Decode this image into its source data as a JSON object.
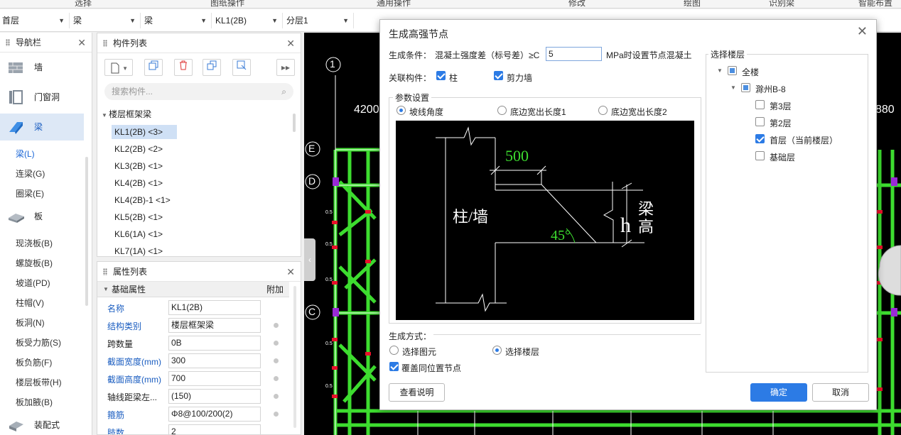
{
  "ribbon": {
    "tabs": [
      "选择",
      "图纸操作",
      "通用操作",
      "修改",
      "绘图",
      "识别梁",
      "智能布置"
    ]
  },
  "selectors": [
    {
      "value": "首层"
    },
    {
      "value": "梁"
    },
    {
      "value": "梁"
    },
    {
      "value": "KL1(2B)"
    },
    {
      "value": "分层1"
    }
  ],
  "nav": {
    "title": "导航栏",
    "categories": [
      {
        "label": "墙",
        "icon": "wall-icon"
      },
      {
        "label": "门窗洞",
        "icon": "door-window-icon"
      },
      {
        "label": "梁",
        "icon": "beam-icon"
      },
      {
        "label": "板",
        "icon": "slab-icon"
      },
      {
        "label": "装配式",
        "icon": "prefab-icon"
      }
    ],
    "beam_items": [
      "梁(L)",
      "连梁(G)",
      "圈梁(E)"
    ],
    "slab_items": [
      "现浇板(B)",
      "螺旋板(B)",
      "坡道(PD)",
      "柱帽(V)",
      "板洞(N)",
      "板受力筋(S)",
      "板负筋(F)",
      "楼层板带(H)",
      "板加腋(B)"
    ]
  },
  "component_list": {
    "title": "构件列表",
    "search_placeholder": "搜索构件...",
    "group": "楼层框架梁",
    "items": [
      "KL1(2B) <3>",
      "KL2(2B) <2>",
      "KL3(2B) <1>",
      "KL4(2B) <1>",
      "KL4(2B)-1 <1>",
      "KL5(2B) <1>",
      "KL6(1A) <1>",
      "KL7(1A) <1>"
    ],
    "more_btn": "▸▸"
  },
  "properties": {
    "title": "属性列表",
    "group": "基础属性",
    "extra_col": "附加",
    "rows": [
      {
        "key": "名称",
        "value": "KL1(2B)"
      },
      {
        "key": "结构类别",
        "value": "楼层框架梁"
      },
      {
        "key": "跨数量",
        "value": "0B"
      },
      {
        "key": "截面宽度(mm)",
        "value": "300"
      },
      {
        "key": "截面高度(mm)",
        "value": "700"
      },
      {
        "key": "轴线距梁左...",
        "value": "(150)"
      },
      {
        "key": "箍筋",
        "value": "Φ8@100/200(2)"
      },
      {
        "key": "肢数",
        "value": "2"
      }
    ]
  },
  "cad": {
    "axis_labels": [
      "1",
      "E",
      "D",
      "C"
    ],
    "dims": [
      "4200",
      "880"
    ]
  },
  "dialog": {
    "title": "生成高强节点",
    "condition_label": "生成条件：",
    "condition_text": "混凝土强度差（标号差）≥C",
    "condition_value": "5",
    "condition_suffix": "MPa时设置节点混凝土",
    "related_label": "关联构件：",
    "related_column": "柱",
    "related_shearwall": "剪力墙",
    "params_legend": "参数设置",
    "params_options": [
      "坡线角度",
      "底边宽出长度1",
      "底边宽出长度2"
    ],
    "diagram": {
      "dim": "500",
      "angle": "45°",
      "left_label": "柱/墙",
      "h": "h",
      "right_label_1": "梁",
      "right_label_2": "高"
    },
    "method_legend": "生成方式：",
    "method_options": [
      "选择图元",
      "选择楼层"
    ],
    "overwrite": "覆盖同位置节点",
    "floor_legend": "选择楼层",
    "floors": {
      "all": "全楼",
      "project": "滁州B-8",
      "items": [
        "第3层",
        "第2层",
        "首层（当前楼层）",
        "基础层"
      ]
    },
    "help_btn": "查看说明",
    "ok_btn": "确定",
    "cancel_btn": "取消"
  },
  "colors": {
    "accent": "#2c7be5",
    "cad_green": "#3ddc2f",
    "cad_bg": "#000000"
  }
}
